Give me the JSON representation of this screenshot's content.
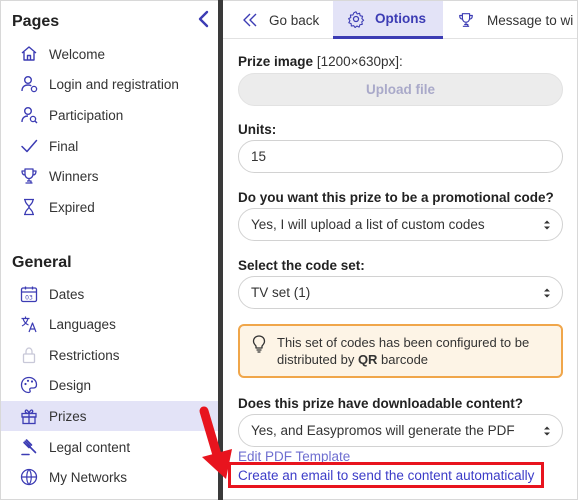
{
  "sidebar": {
    "pages_title": "Pages",
    "general_title": "General",
    "pages_items": [
      {
        "label": "Welcome",
        "icon": "home-icon"
      },
      {
        "label": "Login and registration",
        "icon": "user-login-icon"
      },
      {
        "label": "Participation",
        "icon": "user-search-icon"
      },
      {
        "label": "Final",
        "icon": "checkmark-icon"
      },
      {
        "label": "Winners",
        "icon": "trophy-icon"
      },
      {
        "label": "Expired",
        "icon": "hourglass-icon"
      }
    ],
    "general_items": [
      {
        "label": "Dates",
        "icon": "calendar-icon"
      },
      {
        "label": "Languages",
        "icon": "translate-icon"
      },
      {
        "label": "Restrictions",
        "icon": "lock-icon"
      },
      {
        "label": "Design",
        "icon": "palette-icon"
      },
      {
        "label": "Prizes",
        "icon": "gift-icon",
        "active": true
      },
      {
        "label": "Legal content",
        "icon": "gavel-icon"
      },
      {
        "label": "My Networks",
        "icon": "globe-icon"
      }
    ]
  },
  "tabs": [
    {
      "label": "Go back",
      "icon": "double-chevron-left-icon"
    },
    {
      "label": "Options",
      "icon": "gear-icon",
      "active": true
    },
    {
      "label": "Message to wi",
      "icon": "trophy-icon"
    }
  ],
  "form": {
    "prize_image_label": "Prize image",
    "prize_image_hint": "[1200×630px]:",
    "upload_label": "Upload file",
    "units_label": "Units:",
    "units_value": "15",
    "promo_label": "Do you want this prize to be a promotional code?",
    "promo_value": "Yes, I will upload a list of custom codes",
    "codeset_label": "Select the code set:",
    "codeset_value": "TV set (1)",
    "notice_pre": "This set of codes has been configured to be distributed by ",
    "notice_bold": "QR",
    "notice_post": " barcode",
    "edit_pdf_link": "Edit PDF Template",
    "downloadable_label": "Does this prize have downloadable content?",
    "downloadable_value": "Yes, and Easypromos will generate the PDF",
    "create_email_link": "Create an email to send the content automatically"
  },
  "colors": {
    "accent": "#3c3cb4",
    "active_bg": "#e3e3f7",
    "notice_border": "#f0a64a",
    "notice_bg": "#fdf4e6",
    "annotation_red": "#e8141e"
  }
}
